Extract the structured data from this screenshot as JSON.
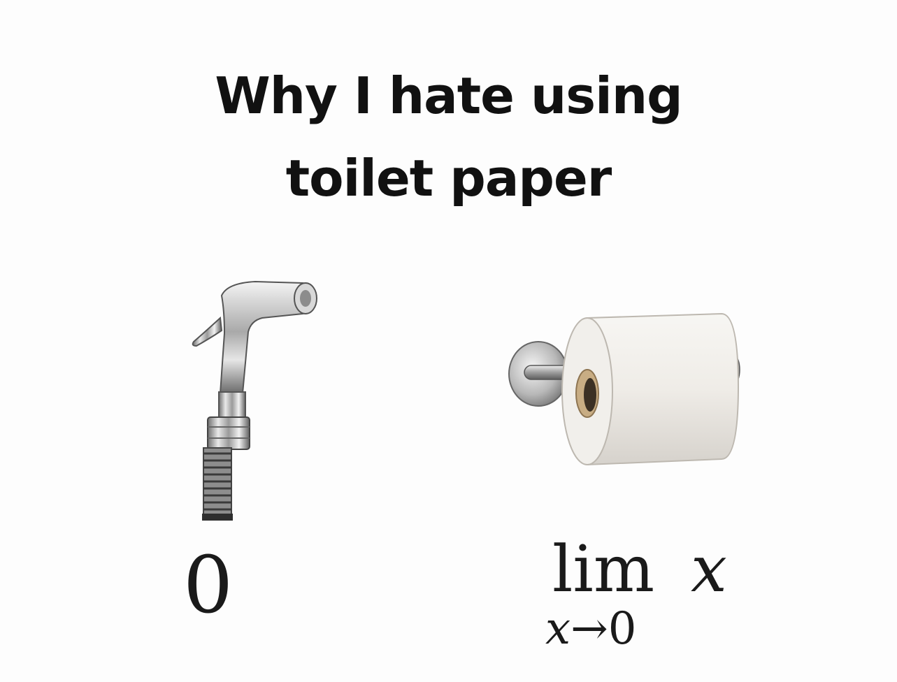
{
  "meme": {
    "title_line1": "Why I hate using",
    "title_line2": "toilet paper"
  },
  "left": {
    "icon": "bidet-sprayer",
    "label": "0"
  },
  "right": {
    "icon": "toilet-paper-roll",
    "limit_word": "lim",
    "limit_variable": "x",
    "subscript_variable": "x",
    "subscript_arrow": "→",
    "subscript_target": "0"
  }
}
